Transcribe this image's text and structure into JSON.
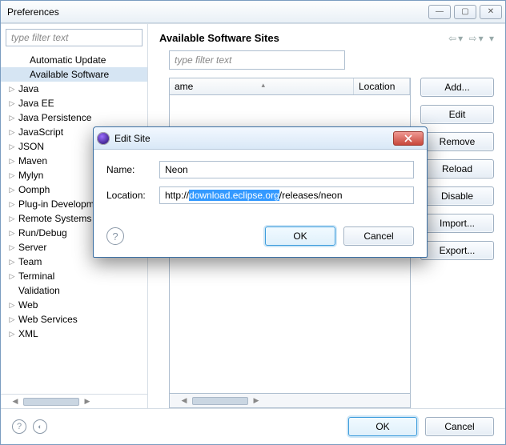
{
  "window": {
    "title": "Preferences"
  },
  "filter_placeholder": "type filter text",
  "tree": {
    "items": [
      {
        "label": "Automatic Update",
        "indent": true,
        "expanded": false,
        "selected": false,
        "has_children": false
      },
      {
        "label": "Available Software",
        "indent": true,
        "expanded": false,
        "selected": true,
        "has_children": false
      },
      {
        "label": "Java",
        "indent": false,
        "expanded": false,
        "selected": false,
        "has_children": true
      },
      {
        "label": "Java EE",
        "indent": false,
        "expanded": false,
        "selected": false,
        "has_children": true
      },
      {
        "label": "Java Persistence",
        "indent": false,
        "expanded": false,
        "selected": false,
        "has_children": true
      },
      {
        "label": "JavaScript",
        "indent": false,
        "expanded": false,
        "selected": false,
        "has_children": true
      },
      {
        "label": "JSON",
        "indent": false,
        "expanded": false,
        "selected": false,
        "has_children": true
      },
      {
        "label": "Maven",
        "indent": false,
        "expanded": false,
        "selected": false,
        "has_children": true
      },
      {
        "label": "Mylyn",
        "indent": false,
        "expanded": false,
        "selected": false,
        "has_children": true
      },
      {
        "label": "Oomph",
        "indent": false,
        "expanded": false,
        "selected": false,
        "has_children": true
      },
      {
        "label": "Plug-in Development",
        "indent": false,
        "expanded": false,
        "selected": false,
        "has_children": true
      },
      {
        "label": "Remote Systems",
        "indent": false,
        "expanded": false,
        "selected": false,
        "has_children": true
      },
      {
        "label": "Run/Debug",
        "indent": false,
        "expanded": false,
        "selected": false,
        "has_children": true
      },
      {
        "label": "Server",
        "indent": false,
        "expanded": false,
        "selected": false,
        "has_children": true
      },
      {
        "label": "Team",
        "indent": false,
        "expanded": false,
        "selected": false,
        "has_children": true
      },
      {
        "label": "Terminal",
        "indent": false,
        "expanded": false,
        "selected": false,
        "has_children": true
      },
      {
        "label": "Validation",
        "indent": false,
        "expanded": false,
        "selected": false,
        "has_children": false
      },
      {
        "label": "Web",
        "indent": false,
        "expanded": false,
        "selected": false,
        "has_children": true
      },
      {
        "label": "Web Services",
        "indent": false,
        "expanded": false,
        "selected": false,
        "has_children": true
      },
      {
        "label": "XML",
        "indent": false,
        "expanded": false,
        "selected": false,
        "has_children": true
      }
    ]
  },
  "page": {
    "title": "Available Software Sites",
    "filter_placeholder": "type filter text",
    "table": {
      "col_name": "ame",
      "col_location": "Location"
    },
    "buttons": {
      "add": "Add...",
      "edit": "Edit",
      "remove": "Remove",
      "reload": "Reload",
      "disable": "Disable",
      "import": "Import...",
      "export": "Export..."
    }
  },
  "footer": {
    "ok": "OK",
    "cancel": "Cancel"
  },
  "dialog": {
    "title": "Edit Site",
    "name_label": "Name:",
    "name_value": "Neon",
    "location_label": "Location:",
    "location_prefix": "http://",
    "location_selected": "download.eclipse.org",
    "location_suffix": "/releases/neon",
    "ok": "OK",
    "cancel": "Cancel"
  }
}
